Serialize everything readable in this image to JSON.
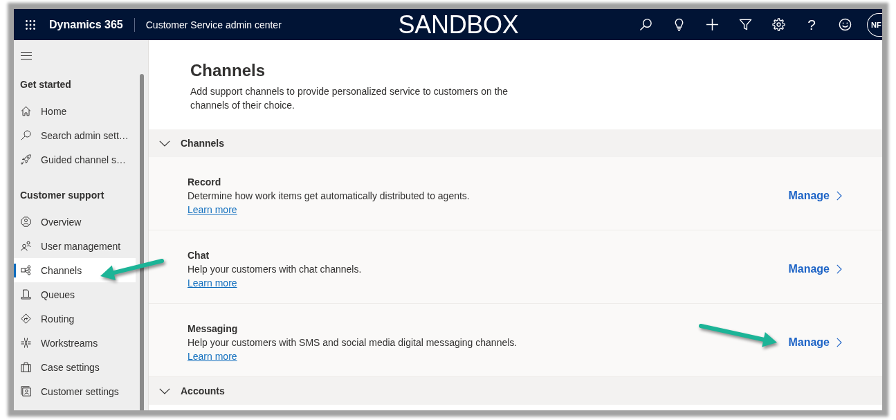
{
  "header": {
    "app_name": "Dynamics 365",
    "area_title": "Customer Service admin center",
    "environment": "SANDBOX",
    "actions": [
      {
        "kind": "search"
      },
      {
        "kind": "lightbulb"
      },
      {
        "kind": "new"
      },
      {
        "kind": "filter"
      },
      {
        "kind": "settings"
      },
      {
        "kind": "help",
        "glyph": "?"
      },
      {
        "kind": "feedback"
      }
    ],
    "avatar": {
      "initials": "NF"
    }
  },
  "sidebar": {
    "sections": [
      {
        "title": "Get started",
        "items": [
          {
            "label": "Home",
            "kind": "home",
            "selected": false,
            "arrow": false
          },
          {
            "label": "Search admin sett…",
            "kind": "search",
            "selected": false,
            "arrow": false
          },
          {
            "label": "Guided channel s…",
            "kind": "guided_setup",
            "selected": false,
            "arrow": false
          }
        ]
      },
      {
        "title": "Customer support",
        "items": [
          {
            "label": "Overview",
            "kind": "overview",
            "selected": false,
            "arrow": false
          },
          {
            "label": "User management",
            "kind": "users",
            "selected": false,
            "arrow": false
          },
          {
            "label": "Channels",
            "kind": "channels",
            "selected": true,
            "arrow": true
          },
          {
            "label": "Queues",
            "kind": "queues",
            "selected": false,
            "arrow": false
          },
          {
            "label": "Routing",
            "kind": "routing",
            "selected": false,
            "arrow": false
          },
          {
            "label": "Workstreams",
            "kind": "workstreams",
            "selected": false,
            "arrow": false
          },
          {
            "label": "Case settings",
            "kind": "case_settings",
            "selected": false,
            "arrow": false
          },
          {
            "label": "Customer settings",
            "kind": "customer_settings",
            "selected": false,
            "arrow": false
          }
        ]
      }
    ]
  },
  "main": {
    "title": "Channels",
    "description": "Add support channels to provide personalized service to customers on the channels of their choice.",
    "sections": [
      {
        "title": "Channels",
        "expanded": true,
        "rows": [
          {
            "title": "Record",
            "description": "Determine how work items get automatically distributed to agents.",
            "link": "Learn more",
            "action": "Manage",
            "arrow": false
          },
          {
            "title": "Chat",
            "description": "Help your customers with chat channels.",
            "link": "Learn more",
            "action": "Manage",
            "arrow": false
          },
          {
            "title": "Messaging",
            "description": "Help your customers with SMS and social media digital messaging channels.",
            "link": "Learn more",
            "action": "Manage",
            "arrow": true
          }
        ]
      },
      {
        "title": "Accounts",
        "expanded": true
      }
    ]
  }
}
